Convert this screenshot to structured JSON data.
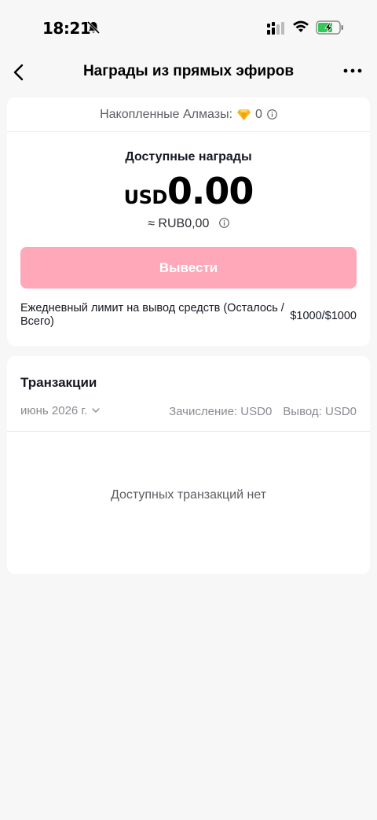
{
  "status_bar": {
    "time": "18:21"
  },
  "header": {
    "title": "Награды из прямых эфиров"
  },
  "rewards": {
    "diamonds_label": "Накопленные Алмазы:",
    "diamonds_value": "0",
    "available_label": "Доступные награды",
    "currency": "USD",
    "amount": "0.00",
    "rub_equivalent": "≈ RUB0,00",
    "withdraw_label": "Вывести",
    "withdraw_enabled": false,
    "limit_label": "Ежедневный лимит на вывод средств (Осталось / Всего)",
    "limit_value": "$1000/$1000"
  },
  "transactions": {
    "title": "Транзакции",
    "month": "июнь 2026 г.",
    "credit": "Зачисление: USD0",
    "withdrawal": "Вывод: USD0",
    "empty_text": "Доступных транзакций нет"
  },
  "colors": {
    "background": "#f7f7f7",
    "card": "#ffffff",
    "withdraw_button_disabled": "#fea8b9",
    "diamond": "#f6b51c",
    "battery_fill": "#34c759"
  },
  "icons": [
    "bell-off-icon",
    "signal-icon",
    "wifi-icon",
    "battery-charging-icon",
    "back-arrow-icon",
    "more-icon",
    "diamond-icon",
    "info-icon",
    "chevron-down-icon"
  ]
}
